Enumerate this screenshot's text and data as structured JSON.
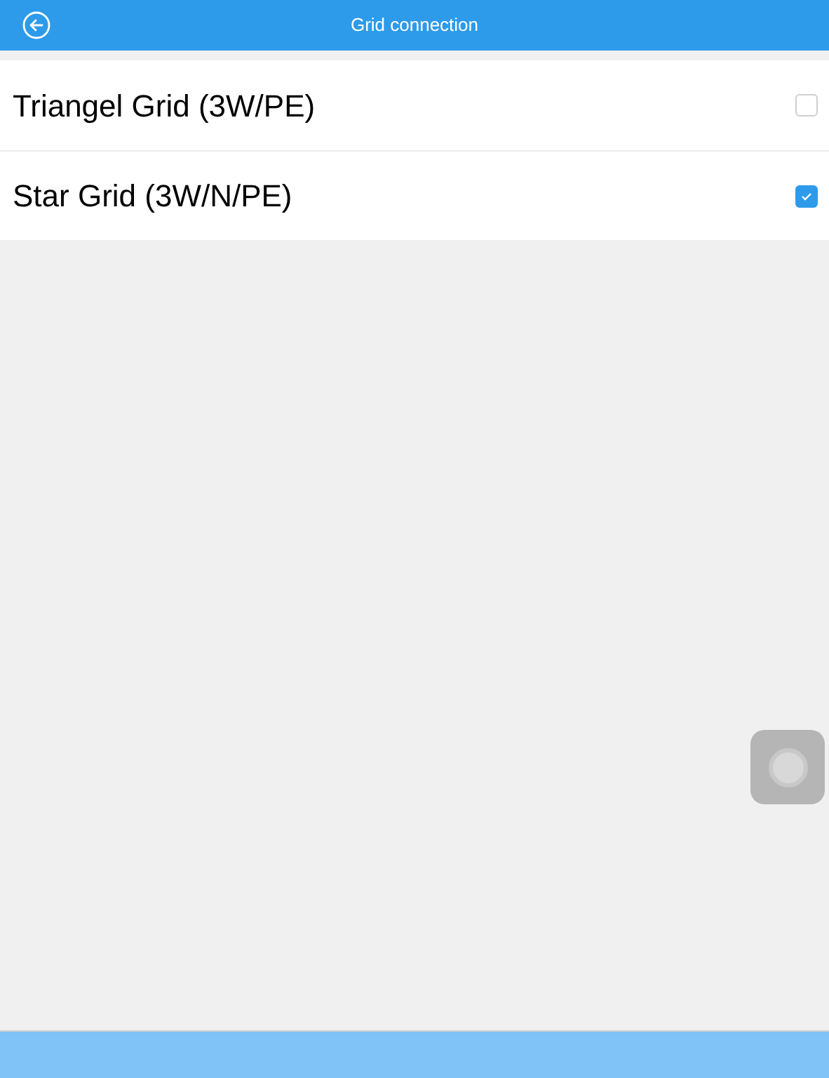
{
  "header": {
    "title": "Grid connection"
  },
  "options": [
    {
      "label": "Triangel Grid (3W/PE)",
      "selected": false
    },
    {
      "label": "Star Grid (3W/N/PE)",
      "selected": true
    }
  ]
}
